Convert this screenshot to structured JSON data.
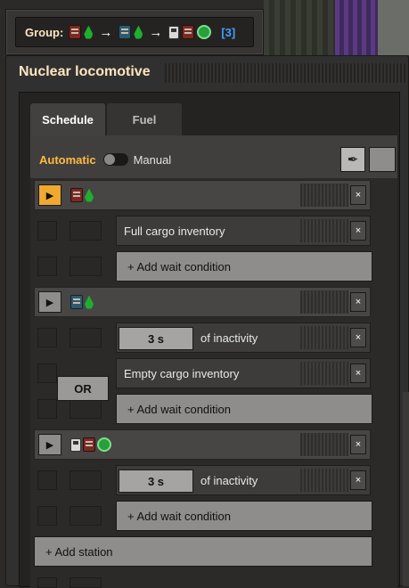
{
  "group": {
    "label": "Group:",
    "count": "[3]",
    "icons": [
      "red-wagon-icon",
      "green-fluid-icon",
      "arrow",
      "blue-wagon-icon",
      "green-fluid-icon",
      "arrow",
      "fuel-pump-icon",
      "red-wagon-icon",
      "green-loco-icon"
    ]
  },
  "window": {
    "title": "Nuclear locomotive"
  },
  "tabs": [
    {
      "label": "Schedule"
    },
    {
      "label": "Fuel"
    }
  ],
  "mode": {
    "automatic": "Automatic",
    "manual": "Manual"
  },
  "stations": [
    {
      "active": true,
      "icons": [
        "red-wagon-icon",
        "green-fluid-icon"
      ],
      "conditions": [
        {
          "text": "Full cargo inventory"
        }
      ],
      "add_condition": "+ Add wait condition"
    },
    {
      "active": false,
      "icons": [
        "blue-wagon-icon",
        "green-fluid-icon"
      ],
      "conditions": [
        {
          "time": "3 s",
          "text": "of inactivity"
        },
        {
          "text": "Empty cargo inventory"
        }
      ],
      "or_label": "OR",
      "add_condition": "+ Add wait condition"
    },
    {
      "active": false,
      "icons": [
        "fuel-pump-icon",
        "red-wagon-icon",
        "green-loco-icon"
      ],
      "conditions": [
        {
          "time": "3 s",
          "text": "of inactivity"
        }
      ],
      "add_condition": "+ Add wait condition"
    }
  ],
  "add_station": "+ Add station",
  "glyphs": {
    "arrow": "→",
    "play": "▶",
    "close": "×",
    "picker": "✒"
  },
  "colors": {
    "accent": "#ffbb40",
    "title": "#ffe6c0",
    "count": "#3fa0ff",
    "active_play": "#f0a830"
  }
}
